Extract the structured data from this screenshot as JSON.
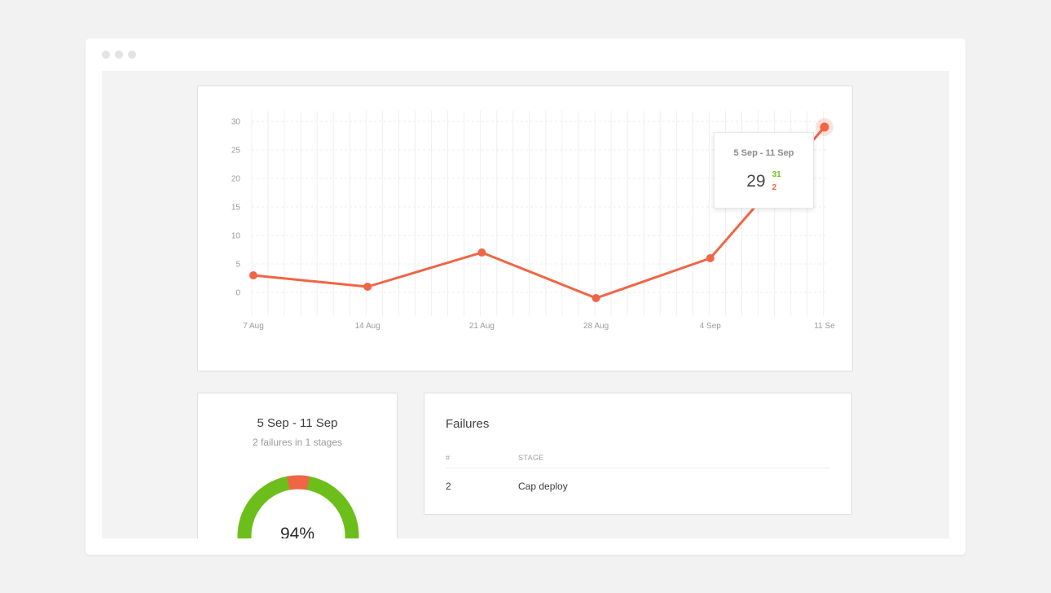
{
  "window": {
    "controls": [
      "close",
      "minimize",
      "maximize"
    ]
  },
  "chart_data": {
    "type": "line",
    "categories": [
      "7 Aug",
      "14 Aug",
      "21 Aug",
      "28 Aug",
      "4 Sep",
      "11 Sep"
    ],
    "x_tick_labels": [
      "7 Aug",
      "14 Aug",
      "21 Aug",
      "28 Aug",
      "4 Sep",
      "11 Se"
    ],
    "values": [
      3,
      1,
      7,
      -1,
      6,
      29
    ],
    "y_ticks": [
      "30",
      "25",
      "20",
      "15",
      "10",
      "5",
      "0"
    ],
    "ylim": [
      0,
      30
    ],
    "grid": true,
    "line_color": "#f06545",
    "highlighted_index": 5
  },
  "tooltip": {
    "range": "5 Sep - 11 Sep",
    "value": "29",
    "success": "31",
    "failures": "2"
  },
  "summary": {
    "title": "5 Sep - 11 Sep",
    "subtitle": "2 failures in 1 stages",
    "percent_label": "94%",
    "success_fraction": 0.94,
    "success_color": "#6cbf1a",
    "failure_color": "#f06545"
  },
  "failures": {
    "title": "Failures",
    "columns": [
      "#",
      "STAGE"
    ],
    "rows": [
      {
        "count": "2",
        "stage": "Cap deploy"
      }
    ]
  }
}
